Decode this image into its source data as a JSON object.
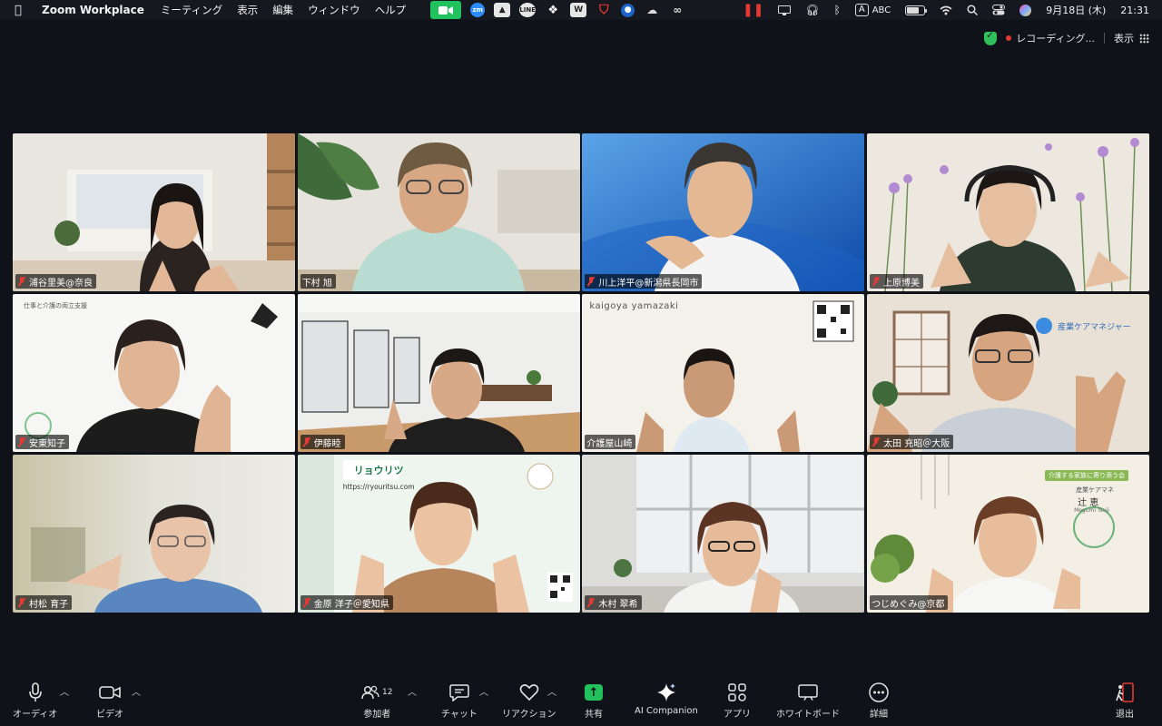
{
  "menubar": {
    "app_name": "Zoom Workplace",
    "menus": [
      "ミーティング",
      "表示",
      "編集",
      "ウィンドウ",
      "ヘルプ"
    ],
    "input_mode": "ABC",
    "date": "9月18日 (木)",
    "time": "21:31",
    "battery_level": 0.7
  },
  "topbar": {
    "recording_label": "レコーディング...",
    "view_label": "表示"
  },
  "participants": [
    {
      "name": "浦谷里美@奈良",
      "muted": true
    },
    {
      "name": "下村 旭",
      "muted": false,
      "active": true
    },
    {
      "name": "川上洋平@新潟県長岡市",
      "muted": true
    },
    {
      "name": "上原博美",
      "muted": true
    },
    {
      "name": "安東知子",
      "muted": true
    },
    {
      "name": "伊藤睦",
      "muted": true
    },
    {
      "name": "介護屋山崎",
      "muted": false
    },
    {
      "name": "太田 充昭＠大阪",
      "muted": true
    },
    {
      "name": "村松 育子",
      "muted": true
    },
    {
      "name": "金原 洋子＠愛知県",
      "muted": true
    },
    {
      "name": "木村 翠希",
      "muted": true
    },
    {
      "name": "つじめぐみ@京都",
      "muted": false
    }
  ],
  "overlays": {
    "tile5_caption": "仕事と介護の両立支援",
    "tile7_brand": "kaigoya yamazaki",
    "tile8_title": "産業ケアマネジャー",
    "tile10_brand": "リョウリツ",
    "tile10_url": "https://ryouritsu.com",
    "tile12_banner": "介護する家族に寄り添う会",
    "tile12_role": "産業ケアマネ",
    "tile12_name": "辻 恵",
    "tile12_roman": "Megumi Tsuji"
  },
  "toolbar": {
    "audio_label": "オーディオ",
    "video_label": "ビデオ",
    "participants_label": "参加者",
    "participants_count": "12",
    "chat_label": "チャット",
    "reactions_label": "リアクション",
    "share_label": "共有",
    "ai_label": "AI Companion",
    "apps_label": "アプリ",
    "whiteboard_label": "ホワイトボード",
    "more_label": "詳細",
    "leave_label": "退出"
  },
  "colors": {
    "active_speaker": "#2eb94e",
    "share_green": "#21c25e",
    "muted_red": "#e53935",
    "background": "#0f1218"
  }
}
